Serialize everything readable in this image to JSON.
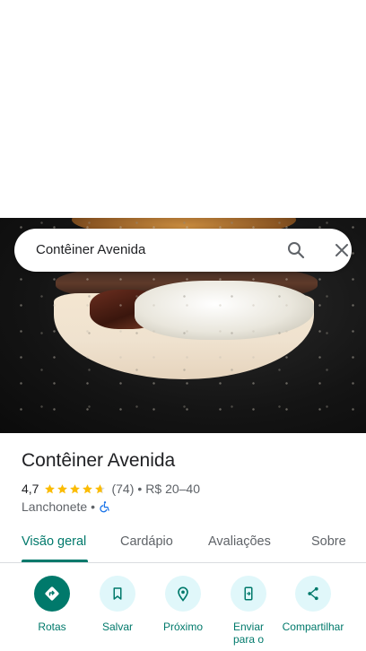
{
  "search": {
    "query": "Contêiner Avenida"
  },
  "place": {
    "name": "Contêiner Avenida",
    "rating": "4,7",
    "stars": 4.7,
    "review_count": "(74)",
    "price_range": "R$ 20–40",
    "separator": "•",
    "category": "Lanchonete •"
  },
  "tabs": [
    {
      "label": "Visão geral",
      "active": true
    },
    {
      "label": "Cardápio",
      "active": false
    },
    {
      "label": "Avaliações",
      "active": false
    },
    {
      "label": "Sobre",
      "active": false
    }
  ],
  "actions": [
    {
      "label": "Rotas",
      "icon": "directions-icon"
    },
    {
      "label": "Salvar",
      "icon": "bookmark-icon"
    },
    {
      "label": "Próximo",
      "icon": "nearby-icon"
    },
    {
      "label": "Enviar para o",
      "icon": "send-to-phone-icon"
    },
    {
      "label": "Compartilhar",
      "icon": "share-icon"
    }
  ],
  "colors": {
    "accent": "#00796b",
    "action_bg": "#e0f7fa",
    "star": "#fbbc04",
    "accessibility": "#1a73e8"
  }
}
